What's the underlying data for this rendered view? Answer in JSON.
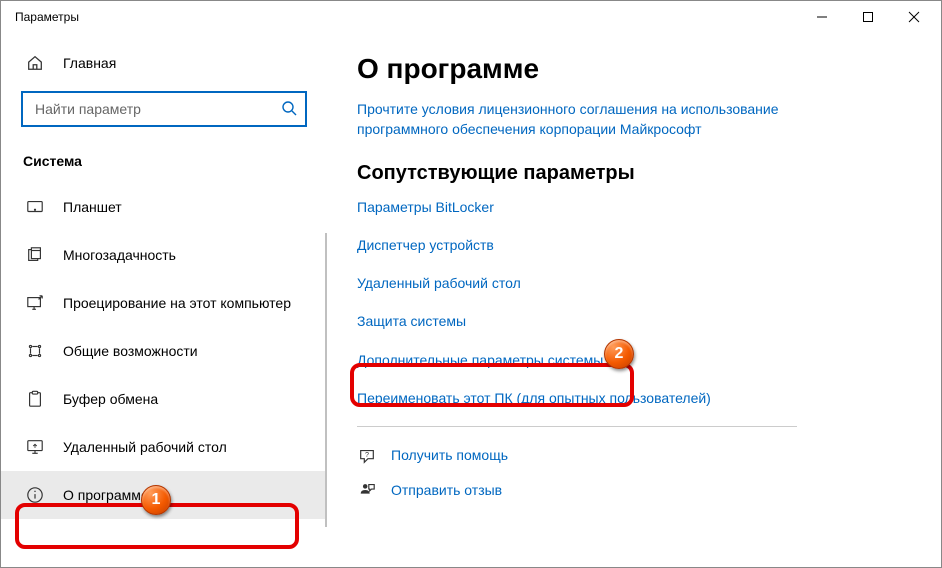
{
  "window": {
    "title": "Параметры"
  },
  "sidebar": {
    "home_label": "Главная",
    "search_placeholder": "Найти параметр",
    "section_label": "Система",
    "items": [
      {
        "label": "Планшет"
      },
      {
        "label": "Многозадачность"
      },
      {
        "label": "Проецирование на этот компьютер"
      },
      {
        "label": "Общие возможности"
      },
      {
        "label": "Буфер обмена"
      },
      {
        "label": "Удаленный рабочий стол"
      },
      {
        "label": "О программе"
      }
    ]
  },
  "main": {
    "heading": "О программе",
    "eula_link": "Прочтите условия лицензионного соглашения на использование программного обеспечения корпорации Майкрософт",
    "related_heading": "Сопутствующие параметры",
    "related_links": [
      "Параметры BitLocker",
      "Диспетчер устройств",
      "Удаленный рабочий стол",
      "Защита системы",
      "Дополнительные параметры системы",
      "Переименовать этот ПК (для опытных пользователей)"
    ],
    "help_link": "Получить помощь",
    "feedback_link": "Отправить отзыв"
  },
  "annotations": {
    "badge1": "1",
    "badge2": "2"
  }
}
